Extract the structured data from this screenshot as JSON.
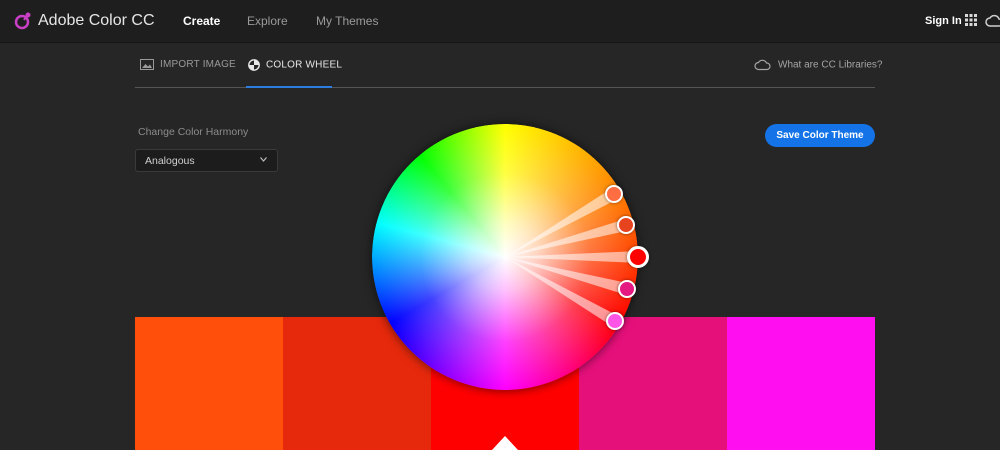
{
  "header": {
    "app_title": "Adobe Color CC",
    "nav": [
      {
        "label": "Create",
        "active": true
      },
      {
        "label": "Explore",
        "active": false
      },
      {
        "label": "My Themes",
        "active": false
      }
    ],
    "sign_in": "Sign In",
    "icons": [
      "adobe-color-logo-icon",
      "apps-grid-icon",
      "creative-cloud-icon"
    ]
  },
  "tabs": [
    {
      "label": "IMPORT IMAGE",
      "icon": "image-icon",
      "active": false
    },
    {
      "label": "COLOR WHEEL",
      "icon": "color-wheel-icon",
      "active": true
    }
  ],
  "libraries_link": "What are CC Libraries?",
  "harmony": {
    "label": "Change Color Harmony",
    "selected": "Analogous"
  },
  "save_button": "Save Color Theme",
  "accent_color": "#1473e6",
  "theme_swatches": [
    "#ff4f0a",
    "#e6290c",
    "#ff0000",
    "#e6107b",
    "#ff0ff0"
  ],
  "wheel": {
    "harmony_rule": "Analogous",
    "handles": [
      {
        "color": "#ff6d43",
        "base": false
      },
      {
        "color": "#e8431f",
        "base": false
      },
      {
        "color": "#ff0000",
        "base": true
      },
      {
        "color": "#e41981",
        "base": false
      },
      {
        "color": "#ff55e6",
        "base": false
      }
    ]
  }
}
